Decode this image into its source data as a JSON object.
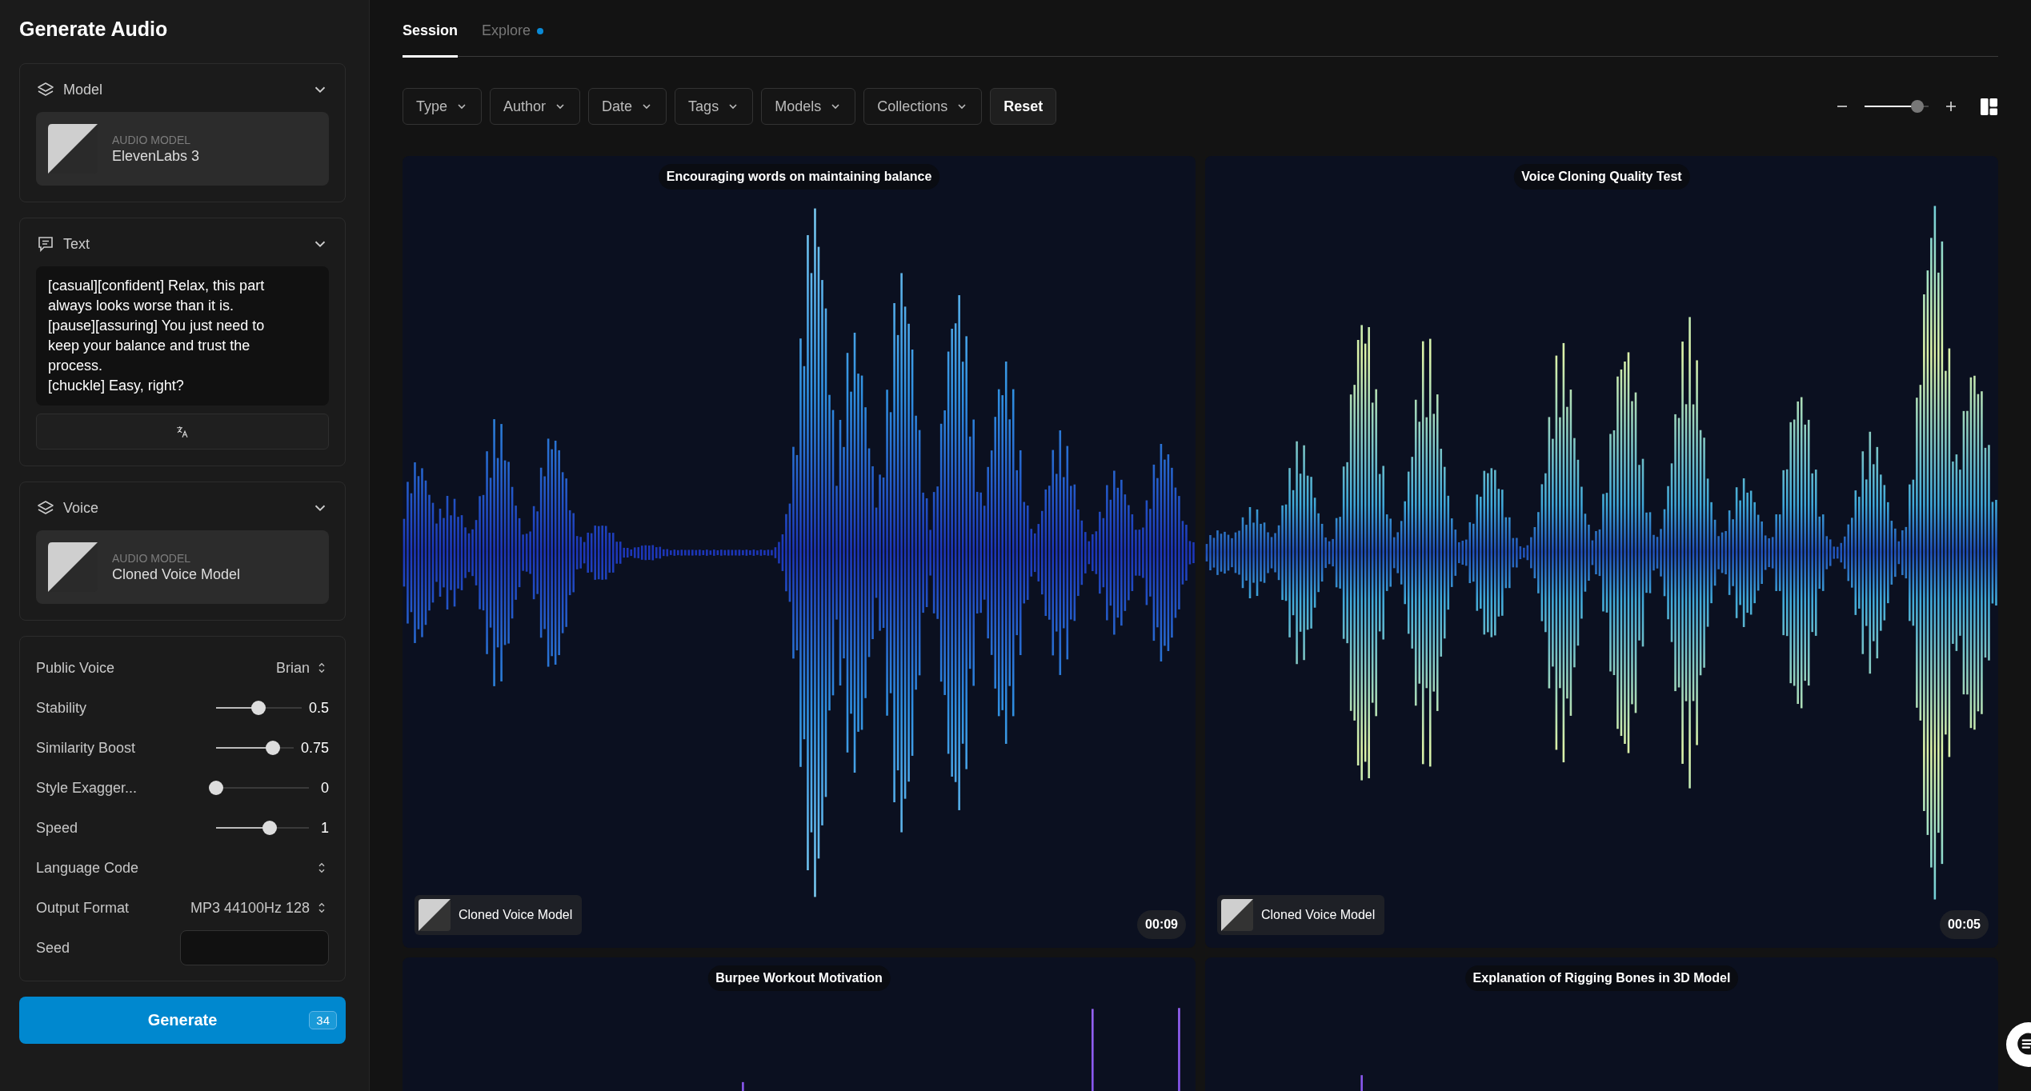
{
  "sidebar": {
    "title": "Generate Audio",
    "model_section": {
      "label": "Model",
      "expanded": true,
      "card": {
        "caption": "AUDIO MODEL",
        "name": "ElevenLabs 3"
      }
    },
    "text_section": {
      "label": "Text",
      "expanded": true,
      "value": "[casual][confident] Relax, this part always looks worse than it is.\n[pause][assuring] You just need to keep your balance and trust the process.\n[chuckle] Easy, right?"
    },
    "voice_section": {
      "label": "Voice",
      "expanded": true,
      "card": {
        "caption": "AUDIO MODEL",
        "name": "Cloned Voice Model"
      }
    },
    "settings": [
      {
        "kind": "select",
        "label": "Public Voice",
        "value": "Brian"
      },
      {
        "kind": "slider",
        "label": "Stability",
        "level": 0.5,
        "reading": "0.5"
      },
      {
        "kind": "slider",
        "label": "Similarity Boost",
        "level": 0.73,
        "reading": "0.75"
      },
      {
        "kind": "slider",
        "label": "Style Exagger...",
        "level": 0,
        "reading": "0"
      },
      {
        "kind": "slider",
        "label": "Speed",
        "level": 0.58,
        "reading": "1"
      },
      {
        "kind": "select",
        "label": "Language Code"
      },
      {
        "kind": "select",
        "label": "Output Format",
        "value": "MP3 44100Hz 128"
      },
      {
        "kind": "input",
        "label": "Seed"
      }
    ],
    "generate": {
      "label": "Generate",
      "credits": "34"
    }
  },
  "main": {
    "tabs": [
      {
        "label": "Session",
        "selected": true,
        "dot": false
      },
      {
        "label": "Explore",
        "selected": false,
        "dot": true
      }
    ],
    "filters": [
      {
        "kind": "dropdown",
        "label": "Type"
      },
      {
        "kind": "dropdown",
        "label": "Author"
      },
      {
        "kind": "dropdown",
        "label": "Date"
      },
      {
        "kind": "dropdown",
        "label": "Tags"
      },
      {
        "kind": "dropdown",
        "label": "Models"
      },
      {
        "kind": "dropdown",
        "label": "Collections"
      },
      {
        "kind": "button",
        "label": "Reset"
      }
    ],
    "zoom": {
      "level": 0.82
    },
    "cards": [
      {
        "title": "Encouraging words on maintaining balance",
        "model": "Cloned Voice Model",
        "duration": "00:09"
      },
      {
        "title": "Voice Cloning Quality Test",
        "model": "Cloned Voice Model",
        "duration": "00:05"
      },
      {
        "title": "Burpee Workout Motivation"
      },
      {
        "title": "Explanation of Rigging Bones in 3D Model"
      }
    ]
  }
}
